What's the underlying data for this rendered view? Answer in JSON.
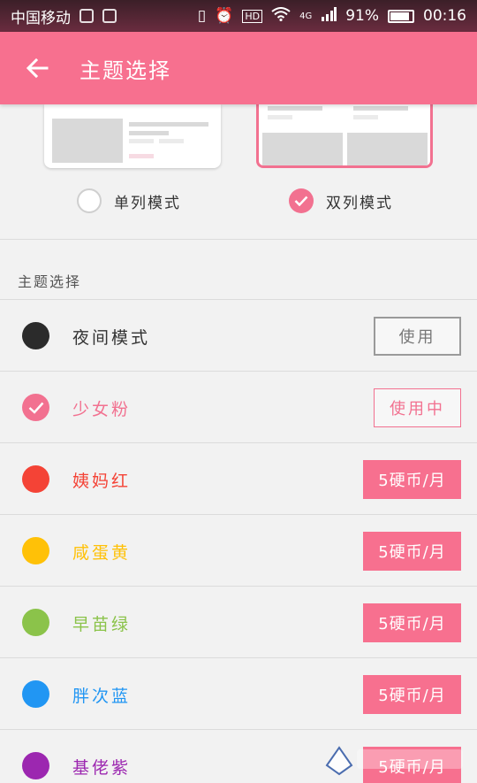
{
  "status_bar": {
    "carrier": "中国移动",
    "network": "4G",
    "battery": "91%",
    "time": "00:16"
  },
  "toolbar": {
    "back_icon": "arrow-left-icon",
    "title": "主题选择"
  },
  "layout_modes": {
    "single": {
      "label": "单列模式",
      "selected": false
    },
    "double": {
      "label": "双列模式",
      "selected": true
    }
  },
  "section": {
    "title": "主题选择"
  },
  "themes": [
    {
      "name": "夜间模式",
      "color": "#2b2b2b",
      "name_color": "#333333",
      "button": "使用",
      "button_style": "outline-gray",
      "selected": false
    },
    {
      "name": "少女粉",
      "color": "#f27190",
      "name_color": "#f27190",
      "button": "使用中",
      "button_style": "outline-pink",
      "selected": true
    },
    {
      "name": "姨妈红",
      "color": "#f44336",
      "name_color": "#f44336",
      "button": "5硬币/月",
      "button_style": "pink",
      "selected": false
    },
    {
      "name": "咸蛋黄",
      "color": "#ffc107",
      "name_color": "#ffc107",
      "button": "5硬币/月",
      "button_style": "pink",
      "selected": false
    },
    {
      "name": "早苗绿",
      "color": "#8bc34a",
      "name_color": "#8bc34a",
      "button": "5硬币/月",
      "button_style": "pink",
      "selected": false
    },
    {
      "name": "胖次蓝",
      "color": "#2196f3",
      "name_color": "#2196f3",
      "button": "5硬币/月",
      "button_style": "pink",
      "selected": false
    },
    {
      "name": "基佬紫",
      "color": "#9c27b0",
      "name_color": "#9c27b0",
      "button": "5硬币/月",
      "button_style": "pink",
      "selected": false
    }
  ]
}
